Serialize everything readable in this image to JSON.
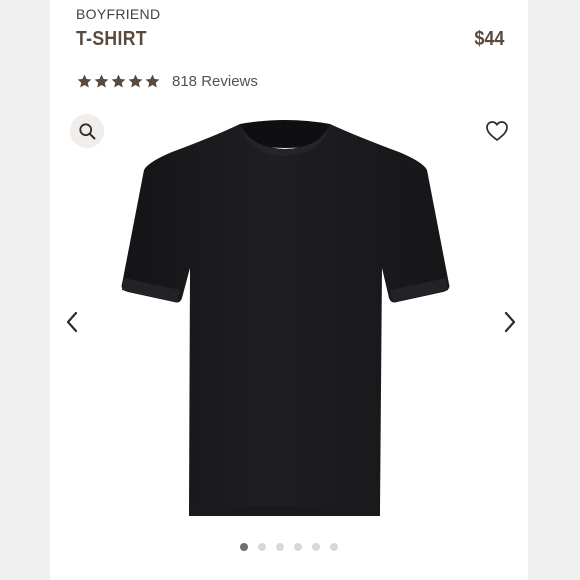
{
  "product": {
    "collection": "BOYFRIEND",
    "name": "T-SHIRT",
    "price": "$44",
    "rating": {
      "stars": 5,
      "reviews_label": "818 Reviews"
    },
    "image_icon": "black-tshirt-image"
  },
  "actions": {
    "search_icon": "magnifier-icon",
    "favorite_icon": "heart-outline-icon",
    "prev_icon": "chevron-left-icon",
    "next_icon": "chevron-right-icon"
  },
  "carousel": {
    "total_slides": 6,
    "active_index": 0
  },
  "colors": {
    "text_primary": "#5a4a3e",
    "star": "#5a4a3e",
    "shirt": "#1c1b1d",
    "dot_active": "#6f6f6f",
    "dot_inactive": "#d8d8d8"
  }
}
